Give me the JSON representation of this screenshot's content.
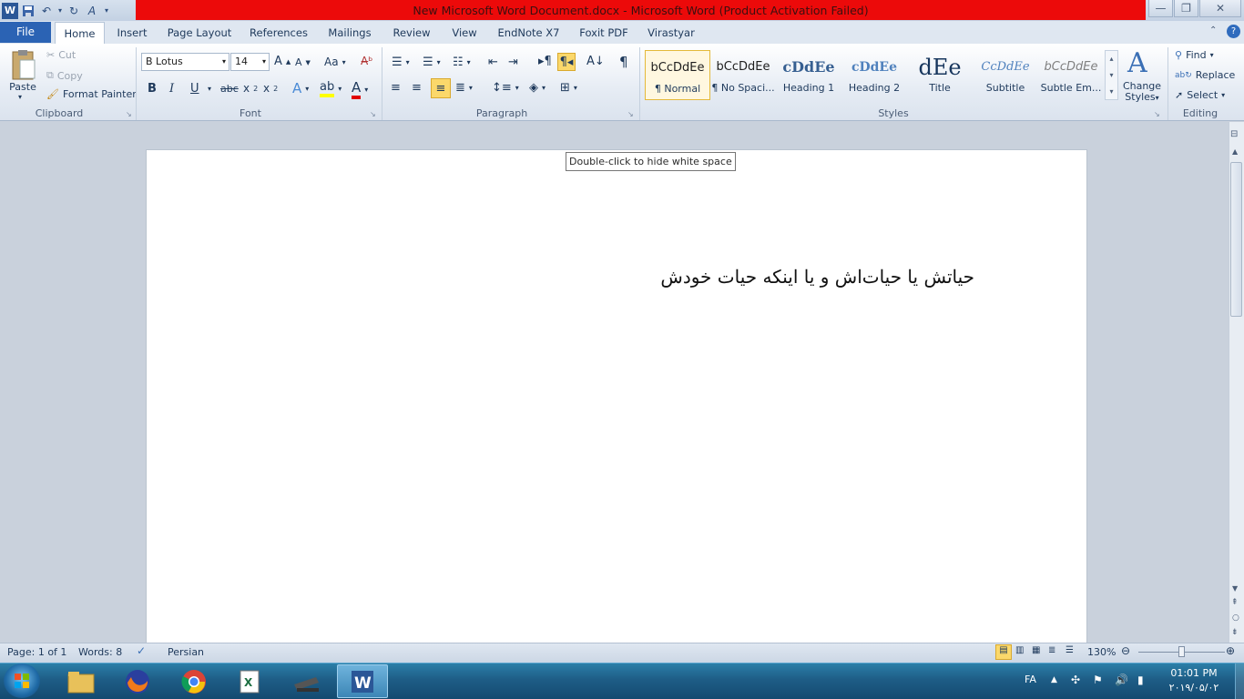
{
  "window": {
    "title": "New Microsoft Word Document.docx  -  Microsoft Word (Product Activation Failed)",
    "title_bar_color": "#ec0a0a"
  },
  "tabs": [
    {
      "label": "File"
    },
    {
      "label": "Home"
    },
    {
      "label": "Insert"
    },
    {
      "label": "Page Layout"
    },
    {
      "label": "References"
    },
    {
      "label": "Mailings"
    },
    {
      "label": "Review"
    },
    {
      "label": "View"
    },
    {
      "label": "EndNote X7"
    },
    {
      "label": "Foxit PDF"
    },
    {
      "label": "Virastyar"
    }
  ],
  "ribbon": {
    "clipboard": {
      "paste": "Paste",
      "cut": "Cut",
      "copy": "Copy",
      "format_painter": "Format Painter",
      "group": "Clipboard"
    },
    "font": {
      "name": "B Lotus",
      "size": "14",
      "group": "Font",
      "case": "Aa"
    },
    "paragraph": {
      "group": "Paragraph"
    },
    "styles": {
      "group": "Styles",
      "items": [
        {
          "preview": "bCcDdEe",
          "name": "¶ Normal"
        },
        {
          "preview": "bCcDdEe",
          "name": "¶ No Spaci..."
        },
        {
          "preview": "cDdEe",
          "name": "Heading 1"
        },
        {
          "preview": "cDdEe",
          "name": "Heading 2"
        },
        {
          "preview": "dEe",
          "name": "Title"
        },
        {
          "preview": "CcDdEe",
          "name": "Subtitle"
        },
        {
          "preview": "bCcDdEe",
          "name": "Subtle Em..."
        }
      ],
      "change_styles": [
        "Change",
        "Styles"
      ]
    },
    "editing": {
      "find": "Find",
      "replace": "Replace",
      "select": "Select",
      "group": "Editing"
    }
  },
  "document": {
    "tooltip": "Double-click to hide white space",
    "text": "حیاتش یا حیات‌اش و یا اینکه حیات خودش"
  },
  "status": {
    "page": "Page: 1 of 1",
    "words": "Words: 8",
    "language": "Persian",
    "zoom": "130%"
  },
  "taskbar": {
    "lang": "FA",
    "time": "01:01 PM",
    "date": "۲۰۱۹/۰۵/۰۲"
  }
}
